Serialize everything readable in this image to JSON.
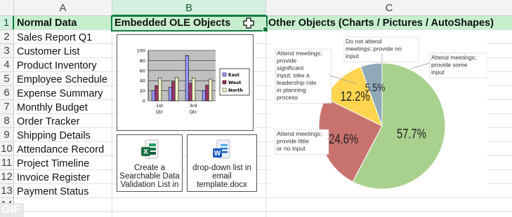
{
  "columns": [
    "A",
    "B",
    "C"
  ],
  "rows": [
    "1",
    "2",
    "3",
    "4",
    "5",
    "6",
    "7",
    "8",
    "9",
    "10",
    "11",
    "12",
    "13",
    "14"
  ],
  "headers": {
    "a1": "Normal Data",
    "b1": "Embedded OLE Objects",
    "c1": "Other Objects (Charts / Pictures / AutoShapes)"
  },
  "column_a_items": [
    "Sales Report Q1",
    "Customer List",
    "Product Inventory",
    "Employee Schedule",
    "Expense Summary",
    "Monthly Budget",
    "Order Tracker",
    "Shipping Details",
    "Attendance Record",
    "Project Timeline",
    "Invoice Register",
    "Payment Status"
  ],
  "embedded_objects": [
    {
      "caption": "Create a Searchable Data Validation List in",
      "app": "X",
      "color": "#1d6f42"
    },
    {
      "caption": "drop-down list in email template.docx",
      "app": "W",
      "color": "#185abd"
    }
  ],
  "watermark": "GIF",
  "chart_data": [
    {
      "type": "bar",
      "ylim": [
        0,
        100
      ],
      "yticks": [
        "100",
        "80",
        "60",
        "40",
        "20",
        "0"
      ],
      "categories": [
        "1st Qtr",
        "3rd Qtr"
      ],
      "category_labels": [
        [
          "1st",
          "Qtr"
        ],
        [
          "3rd",
          "Qtr"
        ]
      ],
      "series": [
        {
          "name": "East",
          "color": "#9999ff",
          "values": [
            20,
            27,
            90,
            20
          ]
        },
        {
          "name": "West",
          "color": "#993366",
          "values": [
            30,
            38,
            35,
            31
          ]
        },
        {
          "name": "North",
          "color": "#ffffcc",
          "values": [
            45,
            46,
            45,
            43
          ]
        }
      ]
    },
    {
      "type": "pie",
      "slices": [
        {
          "label": "57.7%",
          "value": 57.7,
          "color": "#a9d18e",
          "callout": "Attend meetings; provide some input"
        },
        {
          "label": "24.6%",
          "value": 24.6,
          "color": "#c9736f",
          "callout": "Attend meetings; provide little or no input"
        },
        {
          "label": "12.2%",
          "value": 12.2,
          "color": "#ffd54f",
          "callout": "Attend meetings; provide significant input; take a leadership role in planning process"
        },
        {
          "label": "5.5%",
          "value": 5.5,
          "color": "#8fa9b8",
          "callout": "Do not attend meetings; provide no input"
        }
      ]
    }
  ]
}
